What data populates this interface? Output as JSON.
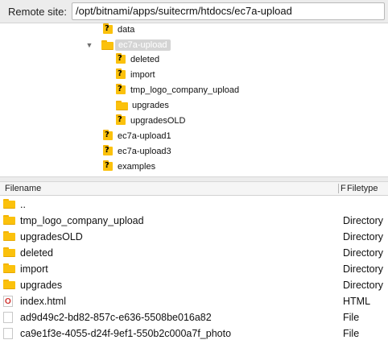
{
  "remote_site": {
    "label": "Remote site:",
    "path": "/opt/bitnami/apps/suitecrm/htdocs/ec7a-upload"
  },
  "tree": {
    "items": [
      {
        "label": "data",
        "icon": "question-folder-icon"
      },
      {
        "label": "ec7a-upload",
        "icon": "folder-icon",
        "selected": true,
        "expanded": true
      },
      {
        "label": "deleted",
        "icon": "question-folder-icon"
      },
      {
        "label": "import",
        "icon": "question-folder-icon"
      },
      {
        "label": "tmp_logo_company_upload",
        "icon": "question-folder-icon"
      },
      {
        "label": "upgrades",
        "icon": "folder-icon"
      },
      {
        "label": "upgradesOLD",
        "icon": "question-folder-icon"
      },
      {
        "label": "ec7a-upload1",
        "icon": "question-folder-icon"
      },
      {
        "label": "ec7a-upload3",
        "icon": "question-folder-icon"
      },
      {
        "label": "examples",
        "icon": "question-folder-icon"
      }
    ]
  },
  "list": {
    "columns": {
      "filename": "Filename",
      "truncated": "F",
      "filetype": "Filetype"
    },
    "rows": [
      {
        "name": "..",
        "type": "",
        "icon": "folder-icon"
      },
      {
        "name": "tmp_logo_company_upload",
        "type": "Directory",
        "icon": "folder-icon"
      },
      {
        "name": "upgradesOLD",
        "type": "Directory",
        "icon": "folder-icon"
      },
      {
        "name": "deleted",
        "type": "Directory",
        "icon": "folder-icon"
      },
      {
        "name": "import",
        "type": "Directory",
        "icon": "folder-icon"
      },
      {
        "name": "upgrades",
        "type": "Directory",
        "icon": "folder-icon"
      },
      {
        "name": "index.html",
        "type": "HTML",
        "icon": "html-file-icon"
      },
      {
        "name": "ad9d49c2-bd82-857c-e636-5508be016a82",
        "type": "File",
        "icon": "file-icon"
      },
      {
        "name": "ca9e1f3e-4055-d24f-9ef1-550b2c000a7f_photo",
        "type": "File",
        "icon": "file-icon"
      }
    ]
  },
  "colors": {
    "folder": "#fbc10c",
    "selection": "#d4d4d4",
    "toolbar_bg": "#ececec"
  }
}
